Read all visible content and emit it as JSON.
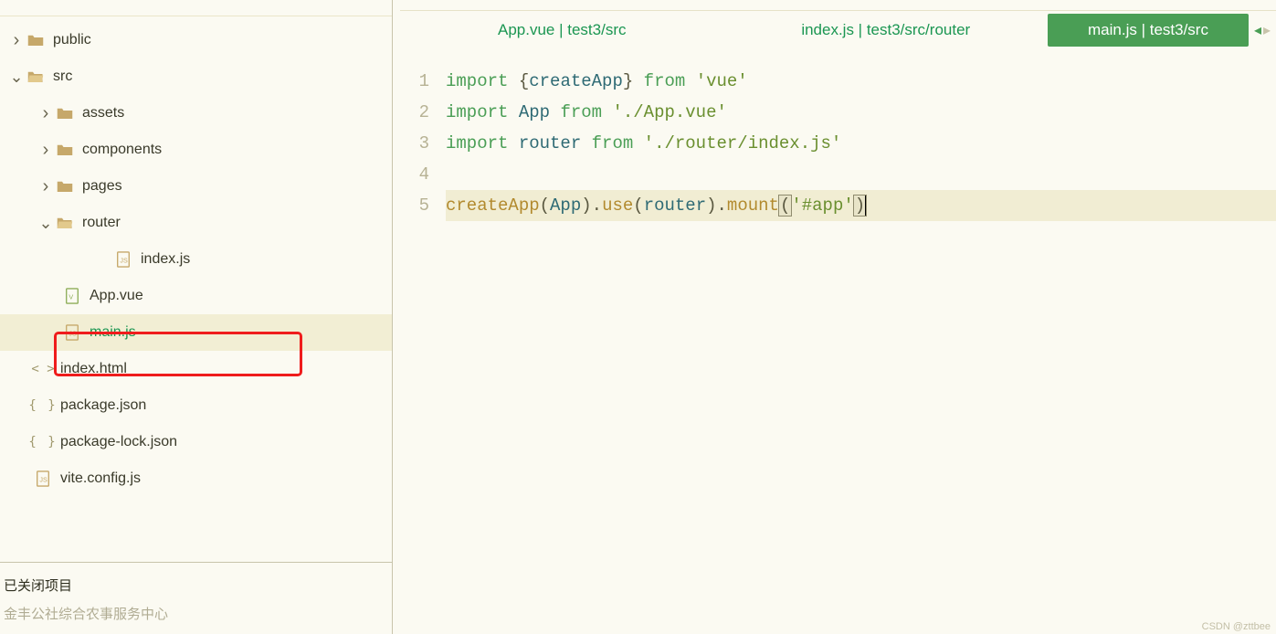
{
  "sidebar": {
    "tree": [
      {
        "name": "public",
        "type": "folder",
        "expanded": false,
        "depth": 0
      },
      {
        "name": "src",
        "type": "folder",
        "expanded": true,
        "depth": 0
      },
      {
        "name": "assets",
        "type": "folder",
        "expanded": false,
        "depth": 1
      },
      {
        "name": "components",
        "type": "folder",
        "expanded": false,
        "depth": 1
      },
      {
        "name": "pages",
        "type": "folder",
        "expanded": false,
        "depth": 1
      },
      {
        "name": "router",
        "type": "folder",
        "expanded": true,
        "depth": 1
      },
      {
        "name": "index.js",
        "type": "file-js",
        "depth": 2
      },
      {
        "name": "App.vue",
        "type": "file-vue",
        "depth": 1
      },
      {
        "name": "main.js",
        "type": "file-js",
        "depth": 1,
        "active": true
      },
      {
        "name": "index.html",
        "type": "file-code",
        "depth": 0
      },
      {
        "name": "package.json",
        "type": "file-brackets",
        "depth": 0
      },
      {
        "name": "package-lock.json",
        "type": "file-brackets",
        "depth": 0
      },
      {
        "name": "vite.config.js",
        "type": "file-js",
        "depth": 0
      }
    ],
    "closed_projects_title": "已关闭项目",
    "closed_projects_item": "金丰公社综合农事服务中心"
  },
  "tabs": {
    "items": [
      {
        "label": "App.vue | test3/src",
        "active": false
      },
      {
        "label": "index.js | test3/src/router",
        "active": false
      },
      {
        "label": "main.js | test3/src",
        "active": true
      }
    ],
    "nav_left": "◂",
    "nav_right": "▸"
  },
  "code": {
    "lines": [
      {
        "n": "1",
        "tokens": [
          [
            "kw",
            "import "
          ],
          [
            "punct",
            "{"
          ],
          [
            "id",
            "createApp"
          ],
          [
            "punct",
            "}"
          ],
          [
            "kw",
            " from "
          ],
          [
            "str",
            "'vue'"
          ]
        ]
      },
      {
        "n": "2",
        "tokens": [
          [
            "kw",
            "import "
          ],
          [
            "id",
            "App"
          ],
          [
            "kw",
            " from "
          ],
          [
            "str",
            "'./App.vue'"
          ]
        ]
      },
      {
        "n": "3",
        "tokens": [
          [
            "kw",
            "import "
          ],
          [
            "id",
            "router"
          ],
          [
            "kw",
            " from "
          ],
          [
            "str",
            "'./router/index.js'"
          ]
        ]
      },
      {
        "n": "4",
        "tokens": []
      },
      {
        "n": "5",
        "tokens": [
          [
            "fn",
            "createApp"
          ],
          [
            "punct",
            "("
          ],
          [
            "id",
            "App"
          ],
          [
            "punct",
            ")."
          ],
          [
            "fn",
            "use"
          ],
          [
            "punct",
            "("
          ],
          [
            "id",
            "router"
          ],
          [
            "punct",
            ")."
          ],
          [
            "fn",
            "mount"
          ],
          [
            "bracket",
            "("
          ],
          [
            "str",
            "'#app'"
          ],
          [
            "bracket",
            ")"
          ],
          [
            "caret",
            ""
          ]
        ]
      }
    ]
  },
  "watermark": "CSDN @zttbee"
}
